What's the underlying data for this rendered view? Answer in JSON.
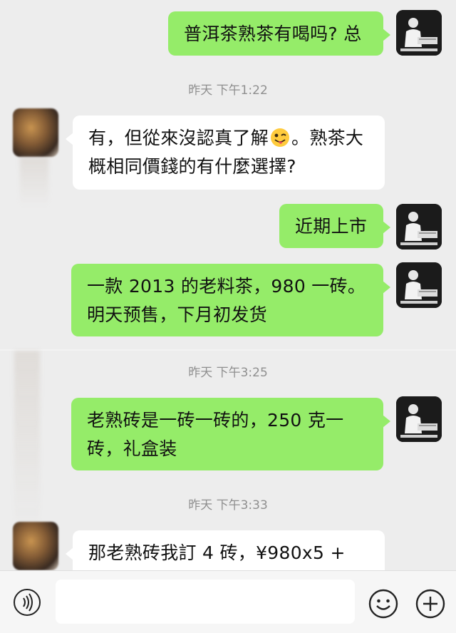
{
  "messages": [
    {
      "from": "self",
      "text": "普洱茶熟茶有喝吗? 总"
    },
    {
      "timestamp": "昨天 下午1:22"
    },
    {
      "from": "other",
      "text_before": "有，但從來沒認真了解",
      "emoji": "winking-tongue-face",
      "text_after": "。熟茶大概相同價錢的有什麼選擇?"
    },
    {
      "from": "self",
      "text": "近期上市"
    },
    {
      "from": "self",
      "text": "一款 2013 的老料茶，980 一砖。明天预售，下月初发货"
    },
    {
      "timestamp": "昨天 下午3:25"
    },
    {
      "from": "self",
      "text": "老熟砖是一砖一砖的，250 克一砖，礼盒装"
    },
    {
      "timestamp": "昨天 下午3:33"
    },
    {
      "from": "other",
      "text": "那老熟砖我訂 4 砖，¥980x5 +"
    }
  ],
  "input_bar": {
    "placeholder": "",
    "icons": [
      "voice-icon",
      "emoji-icon",
      "plus-icon"
    ]
  },
  "colors": {
    "background": "#ededed",
    "self_bubble": "#95ec69",
    "other_bubble": "#ffffff",
    "timestamp_text": "#8f8f8f"
  }
}
